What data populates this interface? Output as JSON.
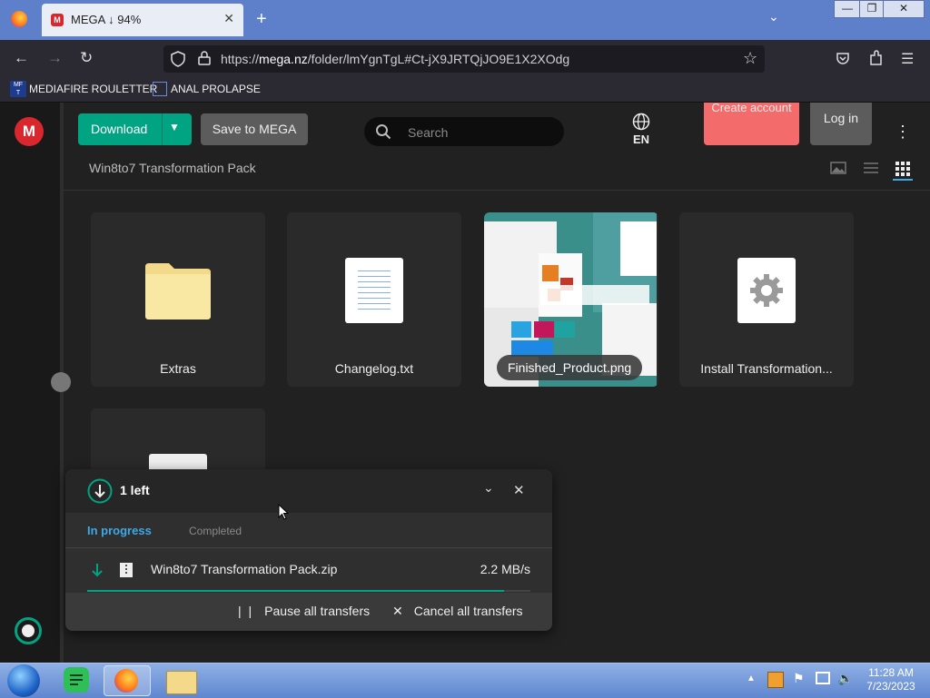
{
  "browser": {
    "tab_title": "MEGA ↓ 94%",
    "tab_favicon": "M",
    "new_tab": "+",
    "tab_close": "✕",
    "url_scheme": "https://",
    "url_host": "mega.nz",
    "url_path": "/folder/lmYgnTgL#Ct-jX9JRTQjJO9E1X2XOdg",
    "bookmarks": [
      {
        "icon": "MF\nT",
        "label": "MEDIAFIRE ROULETTER"
      },
      {
        "icon": "",
        "label": "ANAL PROLAPSE"
      }
    ]
  },
  "toolbar": {
    "logo": "M",
    "download_label": "Download",
    "save_label": "Save to MEGA",
    "search_placeholder": "Search",
    "lang": "EN",
    "create_label": "Create account",
    "login_label": "Log in"
  },
  "breadcrumb": "Win8to7 Transformation Pack",
  "tiles": [
    {
      "name": "Extras",
      "kind": "folder"
    },
    {
      "name": "Changelog.txt",
      "kind": "text"
    },
    {
      "name": "Finished_Product.png",
      "kind": "image"
    },
    {
      "name": "Install Transformation...",
      "kind": "executable"
    }
  ],
  "transfers": {
    "count_label": "1 left",
    "tab_in_progress": "In progress",
    "tab_completed": "Completed",
    "items": [
      {
        "file": "Win8to7 Transformation Pack.zip",
        "speed": "2.2 MB/s",
        "progress": 0.94
      }
    ],
    "pause_label": "Pause all transfers",
    "cancel_label": "Cancel all transfers"
  },
  "taskbar": {
    "time": "11:28 AM",
    "date": "7/23/2023"
  },
  "colors": {
    "accent_green": "#00a382",
    "mega_red": "#d9272e",
    "create_button": "#f46b6b",
    "in_progress_blue": "#3da9e8"
  }
}
